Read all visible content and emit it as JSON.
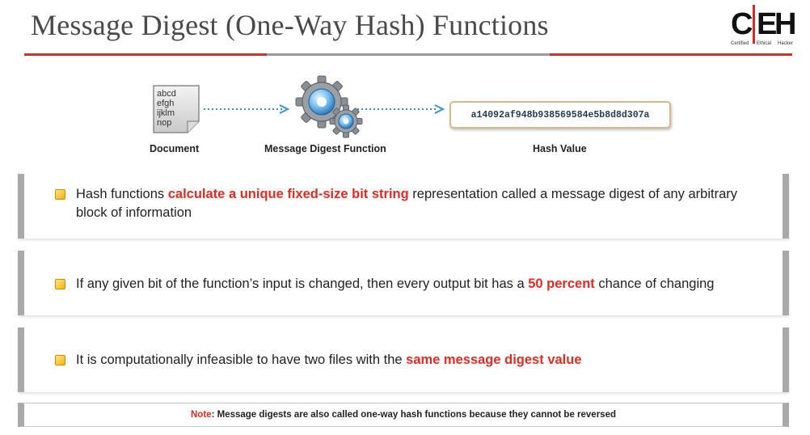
{
  "title": "Message Digest (One-Way Hash) Functions",
  "logo": {
    "main": "CEH",
    "tagline": [
      "Certified",
      "Ethical",
      "Hacker"
    ]
  },
  "diagram": {
    "document_text": [
      "abcd",
      "efgh",
      "ijklm",
      "nop"
    ],
    "document_label": "Document",
    "function_label": "Message Digest Function",
    "hash_value": "a14092af948b938569584e5b8d8d307a",
    "hash_label": "Hash Value"
  },
  "bullets": [
    {
      "pre": "Hash functions ",
      "highlight": "calculate a unique fixed-size bit string",
      "post": " representation called a message digest of any arbitrary block of  information"
    },
    {
      "pre": "If any given bit of the function’s input is changed, then every output bit has a ",
      "highlight": "50 percent",
      "post": " chance of changing"
    },
    {
      "pre": "It is computationally infeasible to have two files with the ",
      "highlight": "same message digest value",
      "post": ""
    }
  ],
  "note": {
    "label": "Note",
    "text": ": Message digests are also called  one-way hash functions because they cannot be reversed"
  },
  "colors": {
    "highlight": "#e22b22",
    "rule": "#c9342c",
    "bullet": "#f2b10f",
    "hash_border": "#d8b98c",
    "arrow": "#3a93cf",
    "logo_red": "#d62a2a"
  }
}
